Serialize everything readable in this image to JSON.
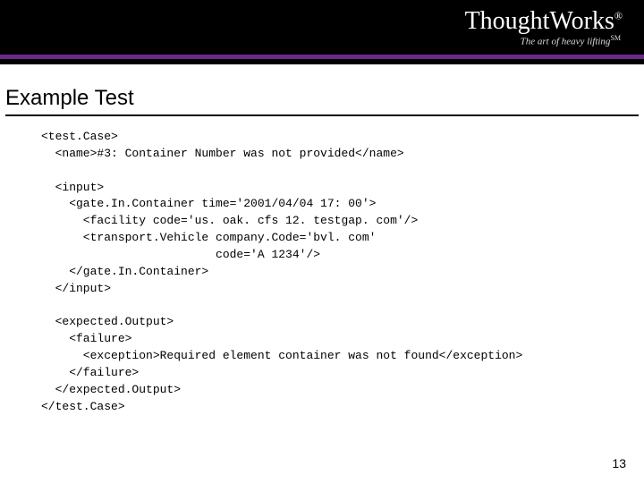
{
  "header": {
    "brand": "ThoughtWorks",
    "reg_mark": "®",
    "tagline": "The art of heavy lifting",
    "sm_mark": "SM"
  },
  "title": "Example Test",
  "code": {
    "l01": "<test.Case>",
    "l02": "  <name>#3: Container Number was not provided</name>",
    "l03": "",
    "l04": "  <input>",
    "l05": "    <gate.In.Container time='2001/04/04 17: 00'>",
    "l06": "      <facility code='us. oak. cfs 12. testgap. com'/>",
    "l07": "      <transport.Vehicle company.Code='bvl. com'",
    "l08": "                         code='A 1234'/>",
    "l09": "    </gate.In.Container>",
    "l10": "  </input>",
    "l11": "",
    "l12": "  <expected.Output>",
    "l13": "    <failure>",
    "l14": "      <exception>Required element container was not found</exception>",
    "l15": "    </failure>",
    "l16": "  </expected.Output>",
    "l17": "</test.Case>"
  },
  "page_number": "13"
}
